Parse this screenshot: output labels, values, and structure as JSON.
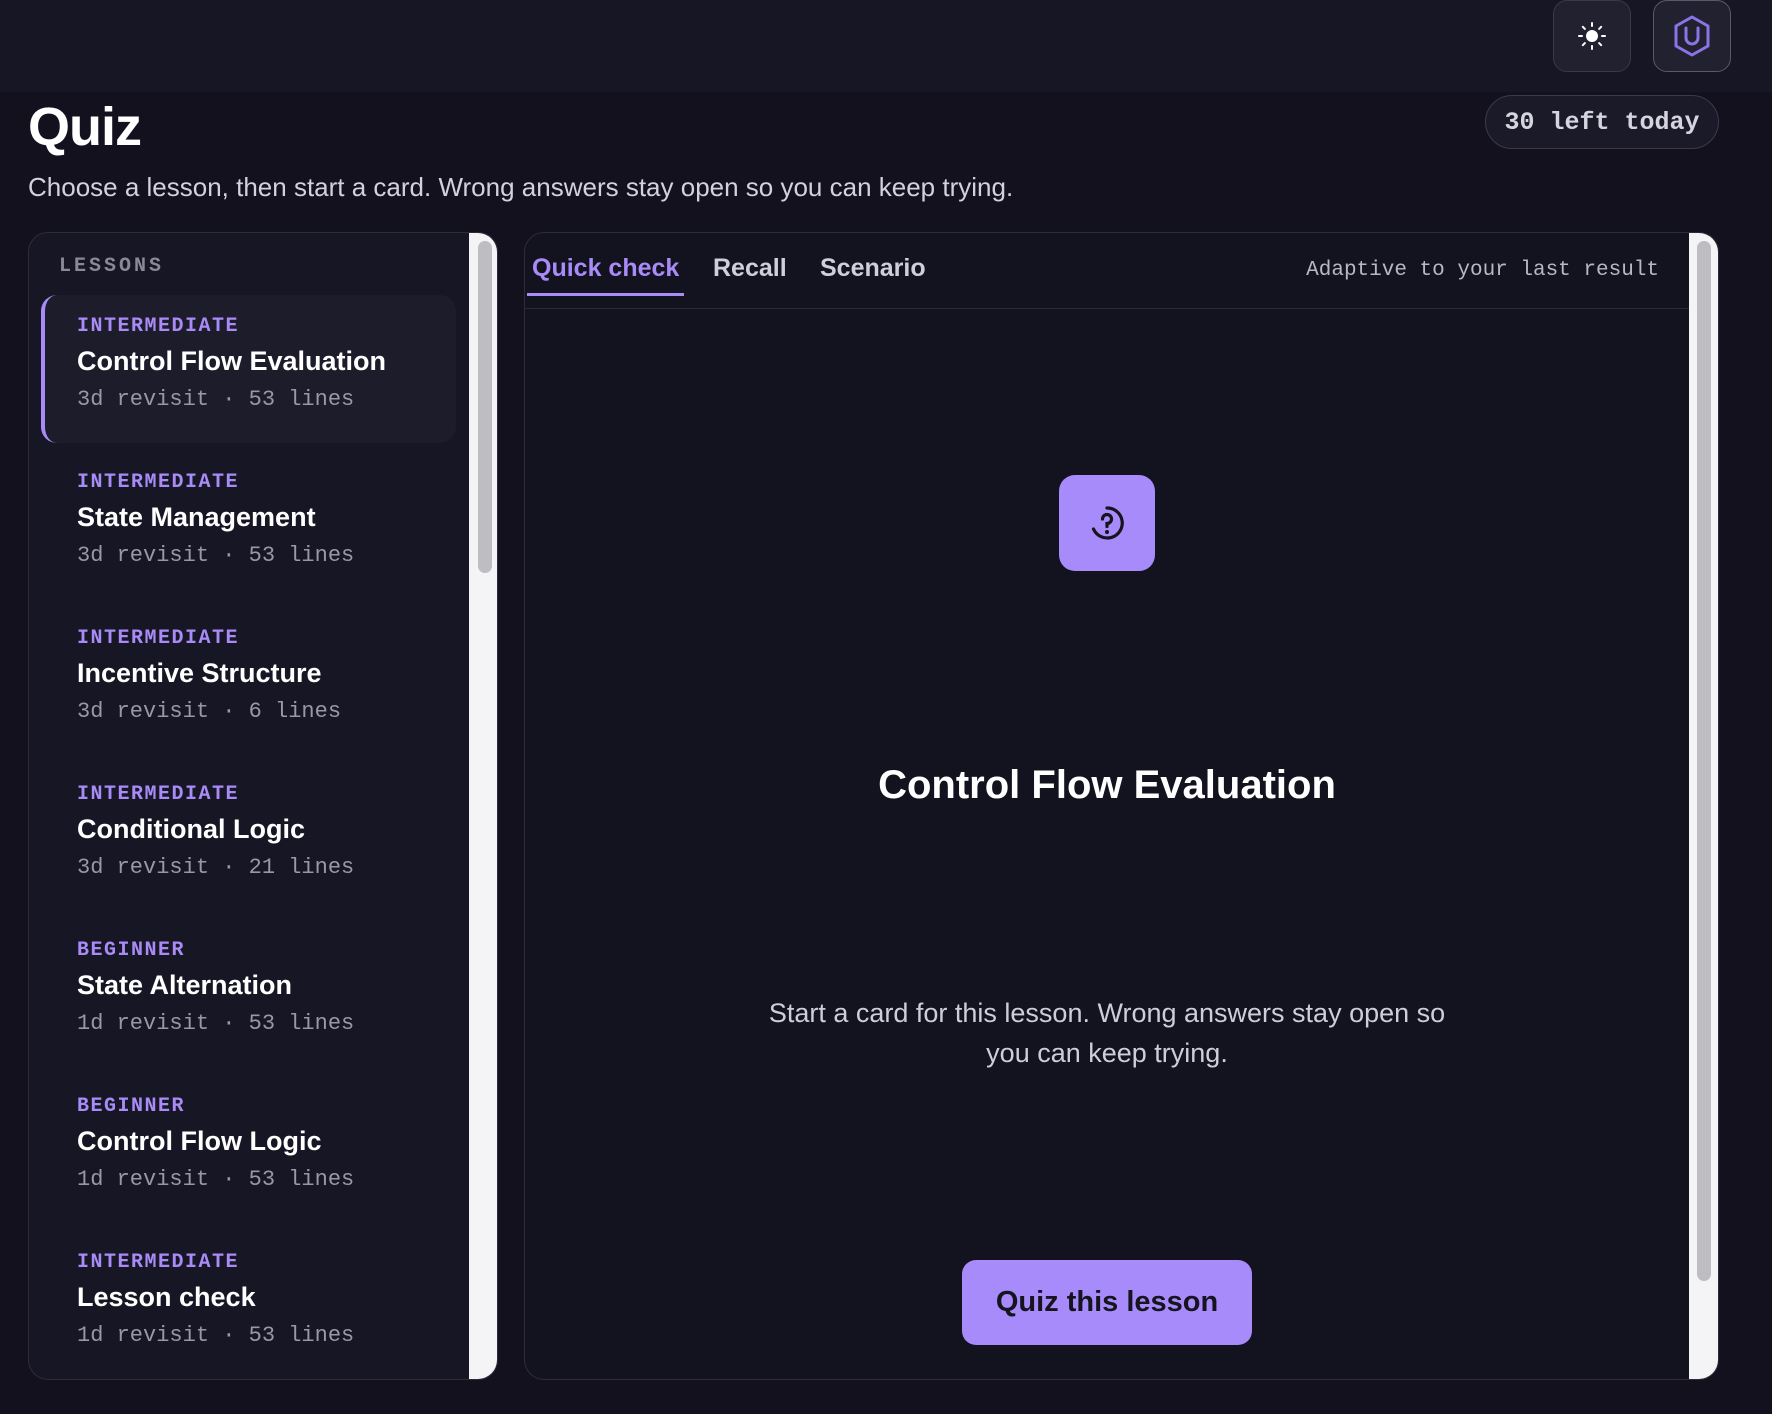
{
  "header": {
    "title": "Quiz",
    "subtitle": "Choose a lesson, then start a card. Wrong answers stay open so you can keep trying.",
    "quota": "30 left today",
    "theme_icon": "sun-icon",
    "account_icon": "shield-u-icon"
  },
  "lessons": {
    "label": "LESSONS",
    "items": [
      {
        "level": "INTERMEDIATE",
        "title": "Control Flow Evaluation",
        "meta": "3d revisit · 53 lines",
        "active": true
      },
      {
        "level": "INTERMEDIATE",
        "title": "State Management",
        "meta": "3d revisit · 53 lines"
      },
      {
        "level": "INTERMEDIATE",
        "title": "Incentive Structure",
        "meta": "3d revisit · 6 lines"
      },
      {
        "level": "INTERMEDIATE",
        "title": "Conditional Logic",
        "meta": "3d revisit · 21 lines"
      },
      {
        "level": "BEGINNER",
        "title": "State Alternation",
        "meta": "1d revisit · 53 lines"
      },
      {
        "level": "BEGINNER",
        "title": "Control Flow Logic",
        "meta": "1d revisit · 53 lines"
      },
      {
        "level": "INTERMEDIATE",
        "title": "Lesson check",
        "meta": "1d revisit · 53 lines"
      }
    ]
  },
  "quiz": {
    "tabs": [
      {
        "label": "Quick check",
        "active": true
      },
      {
        "label": "Recall"
      },
      {
        "label": "Scenario"
      }
    ],
    "adaptive_note": "Adaptive to your last result",
    "icon": "question-spark-icon",
    "title": "Control Flow Evaluation",
    "description": "Start a card for this lesson. Wrong answers stay open so you can keep trying.",
    "button_label": "Quiz this lesson"
  },
  "colors": {
    "accent": "#a78bfa",
    "background": "#12111d"
  }
}
